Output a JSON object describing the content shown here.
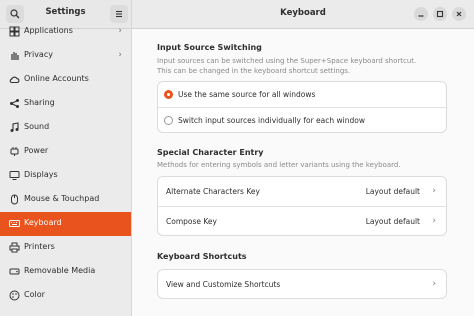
{
  "sidebar": {
    "title": "Settings",
    "items": [
      {
        "label": "Applications",
        "icon": "applications-icon",
        "chevron": "›"
      },
      {
        "label": "Privacy",
        "icon": "privacy-hand-icon",
        "chevron": "›"
      },
      {
        "label": "Online Accounts",
        "icon": "cloud-icon",
        "chevron": ""
      },
      {
        "label": "Sharing",
        "icon": "share-icon",
        "chevron": ""
      },
      {
        "label": "Sound",
        "icon": "music-note-icon",
        "chevron": ""
      },
      {
        "label": "Power",
        "icon": "power-icon",
        "chevron": ""
      },
      {
        "label": "Displays",
        "icon": "monitor-icon",
        "chevron": ""
      },
      {
        "label": "Mouse & Touchpad",
        "icon": "mouse-icon",
        "chevron": ""
      },
      {
        "label": "Keyboard",
        "icon": "keyboard-icon",
        "chevron": "",
        "active": true
      },
      {
        "label": "Printers",
        "icon": "printer-icon",
        "chevron": ""
      },
      {
        "label": "Removable Media",
        "icon": "removable-media-icon",
        "chevron": ""
      },
      {
        "label": "Color",
        "icon": "color-palette-icon",
        "chevron": ""
      }
    ]
  },
  "main": {
    "title": "Keyboard",
    "input_source": {
      "title": "Input Source Switching",
      "desc_line1": "Input sources can be switched using the Super+Space keyboard shortcut.",
      "desc_line2": "This can be changed in the keyboard shortcut settings.",
      "options": [
        {
          "label": "Use the same source for all windows",
          "selected": true
        },
        {
          "label": "Switch input sources individually for each window",
          "selected": false
        }
      ]
    },
    "special_char": {
      "title": "Special Character Entry",
      "desc": "Methods for entering symbols and letter variants using the keyboard.",
      "rows": [
        {
          "label": "Alternate Characters Key",
          "value": "Layout default"
        },
        {
          "label": "Compose Key",
          "value": "Layout default"
        }
      ]
    },
    "shortcuts": {
      "title": "Keyboard Shortcuts",
      "row_label": "View and Customize Shortcuts"
    }
  },
  "colors": {
    "accent": "#e9531d"
  },
  "chevron": "›"
}
